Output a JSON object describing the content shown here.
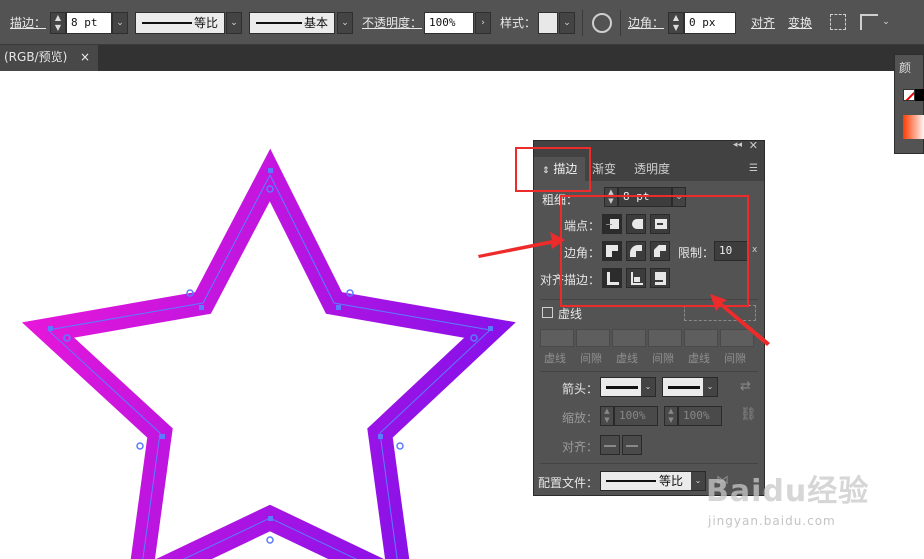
{
  "control_bar": {
    "stroke_label": "描边：",
    "stroke_weight": "8 pt",
    "profile_label": "等比",
    "brush_label": "基本",
    "opacity_label": "不透明度：",
    "opacity_value": "100%",
    "style_label": "样式：",
    "corner_label": "边角：",
    "corner_value": "0 px",
    "align_label": "对齐",
    "transform_label": "变换"
  },
  "document_tab": {
    "title": "(RGB/预览)",
    "close": "×"
  },
  "stroke_panel": {
    "tabs": [
      "描边",
      "渐变",
      "透明度"
    ],
    "weight_label": "粗细：",
    "weight_value": "8 pt",
    "cap_label": "端点：",
    "corner_label": "边角：",
    "limit_label": "限制：",
    "limit_value": "10",
    "align_label": "对齐描边：",
    "dashed_label": "虚线",
    "dash_labels": [
      "虚线",
      "间隙",
      "虚线",
      "间隙",
      "虚线",
      "间隙"
    ],
    "arrowheads_label": "箭头：",
    "scale_label": "缩放：",
    "scale_start": "100%",
    "scale_end": "100%",
    "arrow_align_label": "对齐：",
    "profile_label": "配置文件：",
    "profile_value": "等比"
  },
  "color_panel": {
    "title": "颜"
  },
  "watermark": {
    "brand": "Baidu经验",
    "url": "jingyan.baidu.com"
  },
  "colors": {
    "star_stroke_start": "#ee18d8",
    "star_stroke_end": "#8a12e8",
    "path_line": "#5b7cff",
    "annotation": "#ee2b2b"
  }
}
